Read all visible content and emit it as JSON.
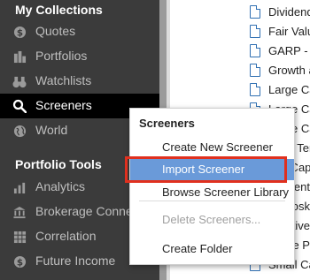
{
  "sidebar": {
    "collections_title": "My Collections",
    "collections": [
      {
        "label": "Quotes",
        "icon": "dollar-circle-icon"
      },
      {
        "label": "Portfolios",
        "icon": "portfolio-icon"
      },
      {
        "label": "Watchlists",
        "icon": "binoculars-icon"
      },
      {
        "label": "Screeners",
        "icon": "search-icon",
        "active": true
      },
      {
        "label": "World",
        "icon": "globe-icon"
      }
    ],
    "tools_title": "Portfolio Tools",
    "tools": [
      {
        "label": "Analytics",
        "icon": "bar-chart-icon"
      },
      {
        "label": "Brokerage Conne",
        "icon": "bank-icon"
      },
      {
        "label": "Correlation",
        "icon": "grid-icon"
      },
      {
        "label": "Future Income",
        "icon": "dollar-circle-icon"
      }
    ]
  },
  "list": {
    "items": [
      "Dividend",
      "Fair Valu",
      "GARP - I",
      "Growth a",
      "Large Ca",
      "Large Ca",
      "Large Ca",
      "Long Ter",
      "Mid Cap",
      "Momentu",
      "Piotroski",
      "Relative",
      "Share Pe",
      "Small Ca"
    ]
  },
  "menu": {
    "header": "Screeners",
    "items": {
      "create_new": "Create New Screener",
      "import": "Import Screener",
      "browse": "Browse Screener Library",
      "delete": "Delete Screeners...",
      "create_folder": "Create Folder"
    }
  },
  "colors": {
    "sidebar_bg": "#3b3b3b",
    "active_bg": "#000000",
    "menu_highlight": "#6a9ad9",
    "callout_red": "#e0301e",
    "doc_icon_blue": "#2f6fb2"
  }
}
